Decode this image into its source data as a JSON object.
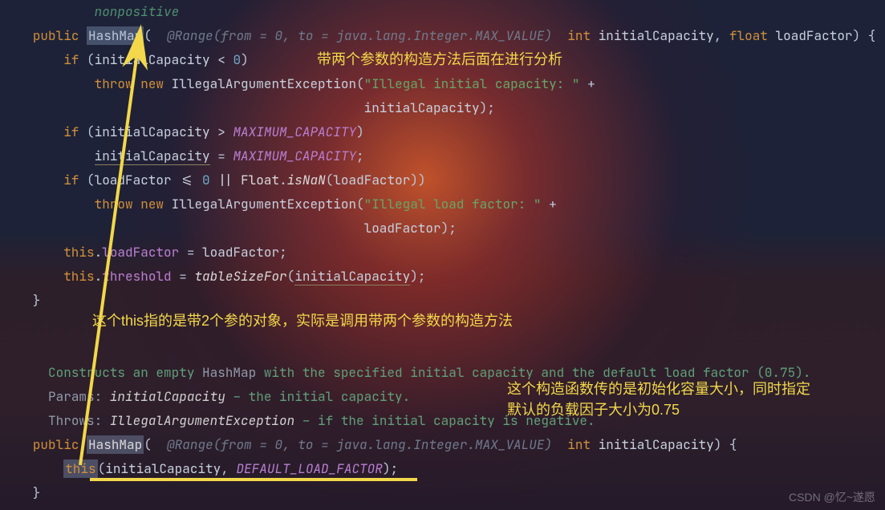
{
  "code": {
    "nonpositive": "nonpositive",
    "kw_public": "public",
    "cls_hashmap": "HashMap",
    "hint_range": "@Range(from = 0, to = java.lang.Integer.MAX_VALUE)",
    "kw_int": "int",
    "id_initialCapacity": "initialCapacity",
    "kw_float": "float",
    "id_loadFactor": "loadFactor",
    "kw_if": "if",
    "zero": "0",
    "kw_throw": "throw",
    "kw_new": "new",
    "cls_iae": "IllegalArgumentException",
    "str_cap": "\"Illegal initial capacity: \"",
    "str_lf": "\"Illegal load factor: \"",
    "const_maxcap": "MAXIMUM_CAPACITY",
    "float_cls": "Float",
    "isnan": "isNaN",
    "kw_this": "this",
    "field_loadFactor": "loadFactor",
    "field_threshold": "threshold",
    "method_tablesizefor": "tableSizeFor",
    "const_default_lf": "DEFAULT_LOAD_FACTOR",
    "doc_line": "Constructs an empty ",
    "doc_hashmap": "HashMap",
    "doc_line2": " with the specified initial capacity and the default load factor (0.75).",
    "doc_params_lbl": "Params:",
    "doc_params_code": "initialCapacity",
    "doc_params_txt": " – the initial capacity.",
    "doc_throws_lbl": "Throws:",
    "doc_throws_code": "IllegalArgumentException",
    "doc_throws_txt": " – if the initial capacity is negative."
  },
  "annotations": {
    "a1": "带两个参数的构造方法后面在进行分析",
    "a2": "这个this指的是带2个参的对象，实际是调用带两个参数的构造方法",
    "a3_l1": "这个构造函数传的是初始化容量大小，同时指定",
    "a3_l2": "默认的负载因子大小为0.75"
  },
  "watermark": "CSDN @忆~遂愿"
}
